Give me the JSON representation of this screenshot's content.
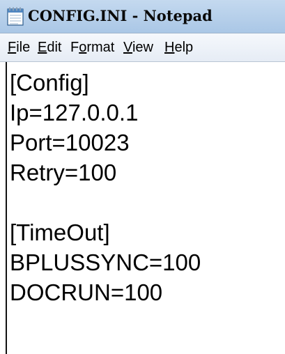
{
  "window": {
    "title": "CONFIG.INI - Notepad",
    "app_icon": "notepad-icon"
  },
  "menu": [
    {
      "label_ak": "F",
      "label_rest": "ile"
    },
    {
      "label_ak": "E",
      "label_rest": "dit"
    },
    {
      "label_pre": "F",
      "label_ak": "o",
      "label_rest": "rmat"
    },
    {
      "label_ak": "V",
      "label_rest": "iew"
    },
    {
      "label_ak": "H",
      "label_rest": "elp"
    }
  ],
  "editor": {
    "lines": [
      "[Config]",
      "Ip=127.0.0.1",
      "Port=10023",
      "Retry=100",
      "",
      "[TimeOut]",
      "BPLUSSYNC=100",
      "DOCRUN=100"
    ]
  }
}
